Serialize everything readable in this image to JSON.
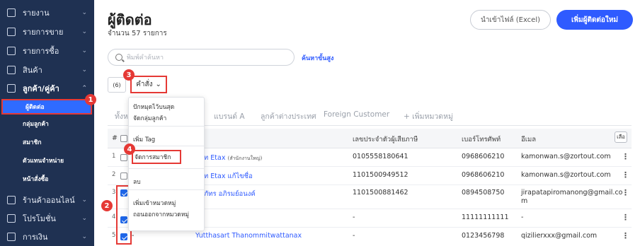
{
  "sidebar": {
    "items": [
      {
        "label": "รายงาน",
        "icon": "report-icon",
        "chevron": "⌄"
      },
      {
        "label": "รายการขาย",
        "icon": "sales-icon",
        "chevron": "⌄"
      },
      {
        "label": "รายการซื้อ",
        "icon": "purchase-icon",
        "chevron": "⌄"
      },
      {
        "label": "สินค้า",
        "icon": "product-icon",
        "chevron": "⌄"
      },
      {
        "label": "ลูกค้า/คู่ค้า",
        "icon": "contacts-icon",
        "chevron": "⌃"
      },
      {
        "label": "ร้านค้าออนไลน์",
        "icon": "store-icon",
        "chevron": "⌄"
      },
      {
        "label": "โปรโมชั่น",
        "icon": "promotion-icon",
        "chevron": "⌄"
      },
      {
        "label": "การเงิน",
        "icon": "finance-icon",
        "chevron": "⌄"
      }
    ],
    "sub_items": [
      "ผู้ติดต่อ",
      "กลุ่มลูกค้า",
      "สมาชิก",
      "ตัวแทนจำหน่าย",
      "หน้าสั่งซื้อ"
    ]
  },
  "header": {
    "title": "ผู้ติดต่อ",
    "subtitle": "จำนวน 57 รายการ",
    "import_label": "นำเข้าไฟล์ (Excel)",
    "add_label": "เพิ่มผู้ติดต่อใหม่"
  },
  "search": {
    "placeholder": "พิมพ์คำค้นหา",
    "advanced_label": "ค้นหาขั้นสูง"
  },
  "selection": {
    "count": "(6)",
    "command_label": "คำสั่ง",
    "command_chevron": "⌄"
  },
  "callouts": [
    "1",
    "2",
    "3",
    "4"
  ],
  "tabs": [
    "ทั้งหม",
    "แบรนด์ A",
    "ลูกค้าต่างประเทศ",
    "Foreign Customer",
    "+ เพิ่มหมวดหมู่"
  ],
  "table": {
    "columns": {
      "hash": "#",
      "tax_id": "เลขประจำตัวผู้เสียภาษี",
      "phone": "เบอร์โทรศัพท์",
      "email": "อีเมล"
    },
    "columns_button": "เลือ",
    "rows": [
      {
        "num": "1",
        "checked": false,
        "name": "ัท Etax",
        "name_small": "(สำนักงานใหญ่)",
        "tax_id": "0105558180641",
        "phone": "0968606210",
        "email": "kamonwan.s@zortout.com",
        "email2": ""
      },
      {
        "num": "2",
        "checked": false,
        "name": "ัท Etax แก้ไขชื่อ",
        "name_small": "",
        "tax_id": "1101500949512",
        "phone": "0968606210",
        "email": "kamonwan.s@zortout.com",
        "email2": ""
      },
      {
        "num": "3",
        "checked": true,
        "name": "ภัทร อภิรมย์อนงค์",
        "name_small": "",
        "tax_id": "1101500881462",
        "phone": "0894508750",
        "email": "jirapatapiromanong@gmail.co",
        "email2": "m"
      },
      {
        "num": "4",
        "checked": true,
        "name": "",
        "name_small": "",
        "tax_id": "-",
        "phone": "11111111111",
        "email": "-",
        "email2": ""
      },
      {
        "num": "5",
        "checked": true,
        "name": "Yutthasart Thanommitwattanax",
        "name_small": "",
        "tax_id": "-",
        "phone": "0123456798",
        "email": "qizilierxxx@gmail.com",
        "email2": "",
        "dash": "-"
      }
    ],
    "row_menu": "⋮"
  },
  "dropdown": {
    "items": [
      "ปักหมุดไว้บนสุด",
      "จัดกลุ่มลูกค้า",
      "เพิ่ม Tag",
      "จัดการสมาชิก",
      "ลบ",
      "เพิ่มเข้าหมวดหมู่",
      "ถอนออกจากหมวดหมู่"
    ]
  },
  "colors": {
    "sidebar_bg": "#1f3152",
    "primary": "#2f5bff",
    "highlight": "#e53935"
  }
}
